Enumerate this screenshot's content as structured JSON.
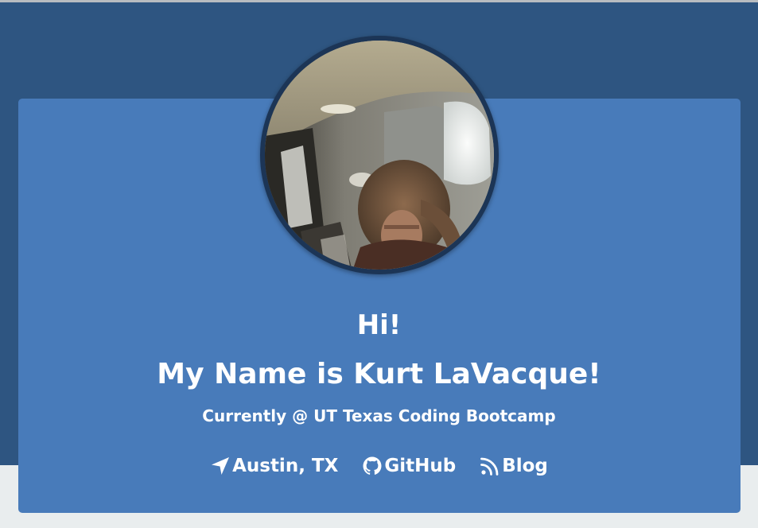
{
  "colors": {
    "header_background": "#2e5581",
    "card_background": "#487bba",
    "page_background": "#e9edee",
    "text": "#ffffff",
    "avatar_border": "#1c3556"
  },
  "profile": {
    "avatar_alt": "Kurt LaVacque profile photo",
    "greeting": "Hi!",
    "name_line": "My Name is Kurt LaVacque!",
    "tagline": "Currently @ UT Texas Coding Bootcamp"
  },
  "links": [
    {
      "label": "Austin, TX",
      "icon": "location-arrow-icon"
    },
    {
      "label": "GitHub",
      "icon": "github-icon"
    },
    {
      "label": "Blog",
      "icon": "rss-icon"
    }
  ]
}
